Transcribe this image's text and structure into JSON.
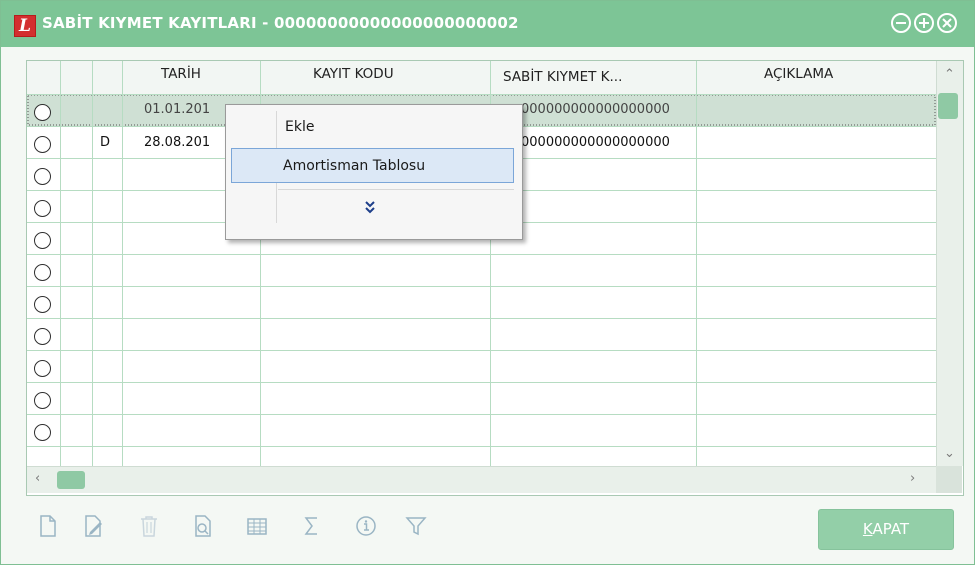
{
  "window": {
    "logo_letter": "L",
    "title": "SABİT KIYMET KAYITLARI - 00000000000000000000002"
  },
  "columns": [
    "TARİH",
    "KAYIT KODU",
    "SABİT KIYMET K...",
    "AÇIKLAMA"
  ],
  "rows": [
    {
      "flag": "",
      "date": "01.01.201",
      "asset_code": "000000000000000000"
    },
    {
      "flag": "D",
      "date": "28.08.201",
      "asset_code": "000000000000000000"
    }
  ],
  "empty_row_count": 9,
  "context_menu": {
    "items": [
      "Ekle",
      "Amortisman Tablosu"
    ],
    "more_icon": "double-chevron-down-icon"
  },
  "toolbar": {
    "icons": [
      "new-document-icon",
      "edit-icon",
      "delete-icon",
      "preview-icon",
      "table-icon",
      "sum-icon",
      "info-icon",
      "filter-icon"
    ]
  },
  "buttons": {
    "close_accel": "K",
    "close_rest": "APAT"
  },
  "colors": {
    "titlebar": "#7dc596",
    "grid_line": "#b6dcc2",
    "selected_row": "#cfe0d4",
    "menu_highlight": "#dce8f6",
    "button": "#93cfa8"
  }
}
